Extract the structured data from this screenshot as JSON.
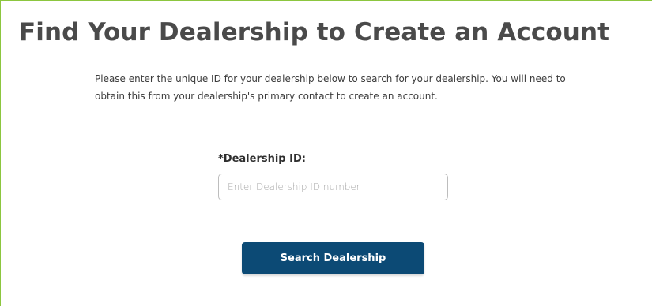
{
  "page": {
    "title": "Find Your Dealership to Create an Account",
    "instructions": "Please enter the unique ID for your dealership below to search for your dealership. You will need to obtain this from your dealership's primary contact to create an account."
  },
  "form": {
    "dealership_id_label": "*Dealership ID:",
    "dealership_id_placeholder": "Enter Dealership ID number",
    "dealership_id_value": "",
    "submit_label": "Search Dealership"
  },
  "colors": {
    "frame_border": "#8cc63f",
    "title_text": "#4a4a4a",
    "button_bg": "#0c4a75",
    "button_text": "#ffffff"
  }
}
